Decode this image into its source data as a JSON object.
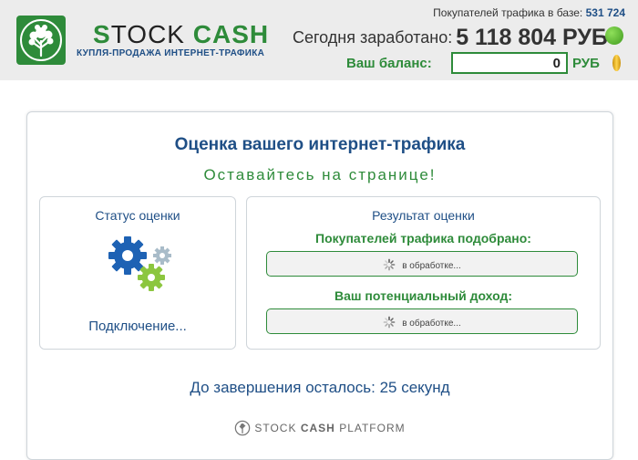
{
  "header": {
    "brand_s": "S",
    "brand_tock": "TOCK",
    "brand_cash": "CASH",
    "tagline": "КУПЛЯ-ПРОДАЖА ИНТЕРНЕТ-ТРАФИКА",
    "buyers_label": "Покупателей трафика в базе:",
    "buyers_count": "531 724",
    "earned_label": "Сегодня заработано:",
    "earned_value": "5 118 804 РУБ",
    "balance_label": "Ваш баланс:",
    "balance_value": "0",
    "balance_currency": "РУБ"
  },
  "card": {
    "title": "Оценка вашего интернет-трафика",
    "subtitle": "Оставайтесь на странице!",
    "status_panel": {
      "heading": "Статус оценки",
      "status": "Подключение..."
    },
    "result_panel": {
      "heading": "Результат оценки",
      "buyers_label": "Покупателей трафика подобрано:",
      "buyers_value": "в обработке...",
      "income_label": "Ваш потенциальный доход:",
      "income_value": "в обработке..."
    },
    "countdown": "До завершения осталось: 25 секунд",
    "platform_stock": "STOCK",
    "platform_cash": "CASH",
    "platform_platform": "PLATFORM"
  },
  "colors": {
    "green": "#2e8b3a",
    "blue": "#1f4f86",
    "header_bg": "#ececec"
  },
  "icons": [
    "tree-logo-icon",
    "green-coin-icon",
    "gold-coin-icon",
    "gears-icon",
    "spinner-icon",
    "platform-logo-icon"
  ]
}
